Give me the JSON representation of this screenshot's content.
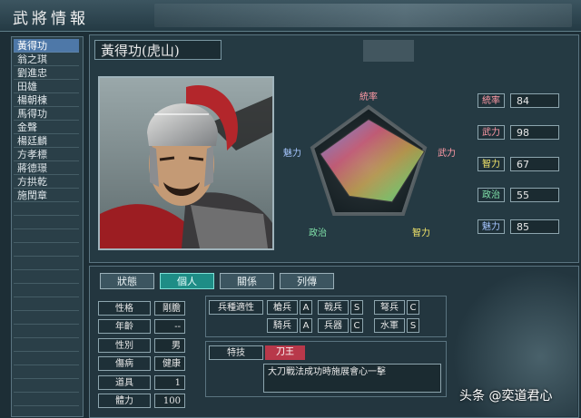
{
  "window": {
    "title": "武將情報"
  },
  "officer_list": [
    "黃得功",
    "翁之琪",
    "劉進忠",
    "田雄",
    "楊朝棟",
    "馬得功",
    "金聲",
    "楊廷麟",
    "方孝標",
    "蔣德璟",
    "方拱乾",
    "施閏章"
  ],
  "selected_index": 0,
  "officer": {
    "name": "黃得功(虎山)"
  },
  "radar": {
    "labels": {
      "top": "統率",
      "right": "武力",
      "bottom_right": "智力",
      "bottom_left": "政治",
      "left": "魅力"
    },
    "values": {
      "統率": 84,
      "武力": 98,
      "智力": 67,
      "政治": 55,
      "魅力": 85
    },
    "max": 100
  },
  "stats": [
    {
      "label": "統率",
      "value": "84",
      "color": "#ff9aa6"
    },
    {
      "label": "武力",
      "value": "98",
      "color": "#ff9aa6"
    },
    {
      "label": "智力",
      "value": "67",
      "color": "#f2e56a"
    },
    {
      "label": "政治",
      "value": "55",
      "color": "#7fe0a8"
    },
    {
      "label": "魅力",
      "value": "85",
      "color": "#a6c6ff"
    }
  ],
  "tabs": [
    "狀態",
    "個人",
    "關係",
    "列傳"
  ],
  "active_tab": 1,
  "attributes": [
    {
      "label": "性格",
      "value": "剛膽"
    },
    {
      "label": "年齡",
      "value": "--"
    },
    {
      "label": "性別",
      "value": "男"
    },
    {
      "label": "傷病",
      "value": "健康"
    },
    {
      "label": "道具",
      "value": "1"
    },
    {
      "label": "體力",
      "value": "100"
    }
  ],
  "aptitude": {
    "title": "兵種適性",
    "items": [
      {
        "name": "槍兵",
        "grade": "A"
      },
      {
        "name": "戟兵",
        "grade": "S"
      },
      {
        "name": "弩兵",
        "grade": "C"
      },
      {
        "name": "騎兵",
        "grade": "A"
      },
      {
        "name": "兵器",
        "grade": "C"
      },
      {
        "name": "水軍",
        "grade": "S"
      }
    ]
  },
  "skill": {
    "label": "特技",
    "name": "刀王",
    "description": "大刀戰法成功時施展會心一擊"
  },
  "watermark": "头条 @奕道君心"
}
